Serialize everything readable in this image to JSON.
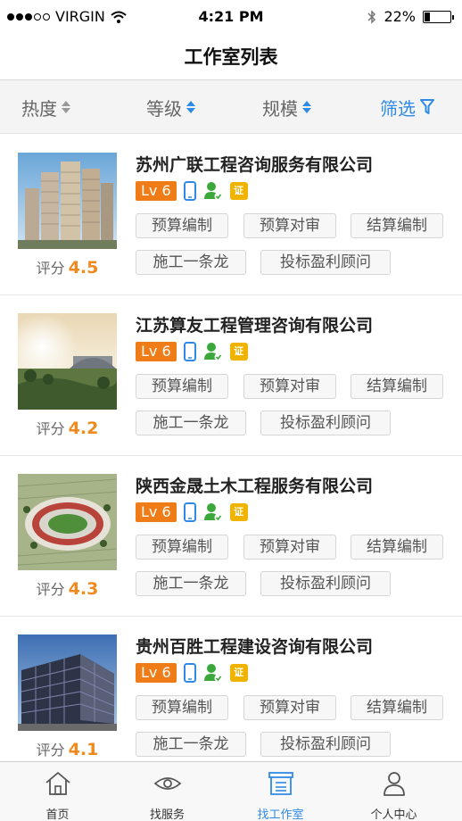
{
  "status_bar": {
    "carrier": "VIRGIN",
    "time": "4:21 PM",
    "battery": "22%",
    "battery_level": 0.22
  },
  "header": {
    "title": "工作室列表"
  },
  "sort_bar": {
    "items": [
      {
        "label": "热度"
      },
      {
        "label": "等级"
      },
      {
        "label": "规模"
      }
    ],
    "filter_label": "筛选"
  },
  "rating_label": "评分",
  "level_label": "Lv 6",
  "cert_label": "证",
  "studios": [
    {
      "name": "苏州广联工程咨询服务有限公司",
      "score": "4.5",
      "tags": [
        "预算编制",
        "预算对审",
        "结算编制",
        "施工一条龙",
        "投标盈利顾问"
      ]
    },
    {
      "name": "江苏算友工程管理咨询有限公司",
      "score": "4.2",
      "tags": [
        "预算编制",
        "预算对审",
        "结算编制",
        "施工一条龙",
        "投标盈利顾问"
      ]
    },
    {
      "name": "陕西金晟土木工程服务有限公司",
      "score": "4.3",
      "tags": [
        "预算编制",
        "预算对审",
        "结算编制",
        "施工一条龙",
        "投标盈利顾问"
      ]
    },
    {
      "name": "贵州百胜工程建设咨询有限公司",
      "score": "4.1",
      "tags": [
        "预算编制",
        "预算对审",
        "结算编制",
        "施工一条龙",
        "投标盈利顾问"
      ]
    }
  ],
  "tab_bar": {
    "tabs": [
      {
        "label": "首页",
        "icon": "home-icon"
      },
      {
        "label": "找服务",
        "icon": "eye-icon"
      },
      {
        "label": "找工作室",
        "icon": "studio-icon"
      },
      {
        "label": "个人中心",
        "icon": "person-icon"
      }
    ],
    "active_index": 2
  },
  "colors": {
    "accent": "#2e8ae6",
    "score": "#f08a1c",
    "level_badge": "#f07c17",
    "phone_icon": "#2e8ae6",
    "verified_icon": "#3aa83a",
    "cert_icon": "#f0b400"
  }
}
